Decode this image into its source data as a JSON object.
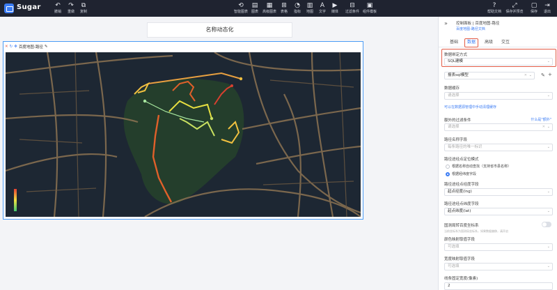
{
  "app": {
    "title": "Sugar"
  },
  "toolbar_left": [
    {
      "name": "undo",
      "icon": "↶",
      "label": "撤销"
    },
    {
      "name": "redo",
      "icon": "↷",
      "label": "重做"
    },
    {
      "name": "copy",
      "icon": "⧉",
      "label": "复制"
    }
  ],
  "toolbar_center": [
    {
      "name": "smart-chart",
      "icon": "⟲",
      "label": "智能图表"
    },
    {
      "name": "chart",
      "icon": "▤",
      "label": "图表"
    },
    {
      "name": "advanced-chart",
      "icon": "▦",
      "label": "高级图表"
    },
    {
      "name": "table",
      "icon": "⊞",
      "label": "表格"
    },
    {
      "name": "metric",
      "icon": "◔",
      "label": "指标"
    },
    {
      "name": "map",
      "icon": "▥",
      "label": "地图"
    },
    {
      "name": "text",
      "icon": "A",
      "label": "文字"
    },
    {
      "name": "media",
      "icon": "▶",
      "label": "媒体"
    },
    {
      "name": "filter",
      "icon": "⊟",
      "label": "过滤条件"
    },
    {
      "name": "component-template",
      "icon": "▣",
      "label": "组件模板"
    }
  ],
  "toolbar_right": [
    {
      "name": "help-doc",
      "icon": "?",
      "label": "帮助文档"
    },
    {
      "name": "save-preview",
      "icon": "⤢",
      "label": "保存并预览"
    },
    {
      "name": "save",
      "icon": "▢",
      "label": "保存"
    },
    {
      "name": "exit",
      "icon": "⇥",
      "label": "退出"
    }
  ],
  "dashboard": {
    "title": "名称动态化"
  },
  "widget": {
    "title": "百度地图-路径",
    "icon_close": "✕",
    "icon_refresh": "↻",
    "icon_move": "✥",
    "icon_edit": "✎"
  },
  "panel": {
    "collapse_icon": "»",
    "breadcrumb": "控制面板 | 百度地图-路径",
    "doc_link": "百度地图-路径文档",
    "tabs": [
      "基础",
      "数据",
      "高级",
      "交互"
    ],
    "active_tab": "数据",
    "binding": {
      "label": "数据绑定方式",
      "value": "SQL建模"
    },
    "model": {
      "value": "报表sql模型",
      "edit_icon": "✎",
      "add_icon": "+"
    },
    "cache": {
      "label": "数据缓存",
      "placeholder": "请选择"
    },
    "cache_link": "可以在数据源管理中手动清理缓存",
    "filter": {
      "label": "额外的过滤条件",
      "help": "什么是\"额外\"",
      "placeholder": "请选择"
    },
    "path_name": {
      "label": "路径名称字段",
      "placeholder": "每条路径的唯一标识"
    },
    "locate": {
      "label": "路径途经点定位模式",
      "opt1": "根据名称自动查找（支持省市县名称）",
      "opt2": "根据经纬度字段",
      "selected": "opt2"
    },
    "lng": {
      "label": "路径途经点经度字段",
      "value": "起点经度(lng)"
    },
    "lat": {
      "label": "路径途经点纬度字段",
      "value": "起点纬度(lat)"
    },
    "coord": {
      "label": "国测局转百度坐标系",
      "hint": "当前坐标系为国测局坐标系，如果数据偏移，请开启"
    },
    "color_field": {
      "label": "颜色映射取值字段",
      "placeholder": "可选填"
    },
    "width_field": {
      "label": "宽度映射取值字段",
      "placeholder": "可选填"
    },
    "fixed_width": {
      "label": "线条固定宽度(像素)",
      "value": "2"
    }
  },
  "map_colors": {
    "background": "#1d2733",
    "road": "#b9986b",
    "park": "#243e2c"
  }
}
